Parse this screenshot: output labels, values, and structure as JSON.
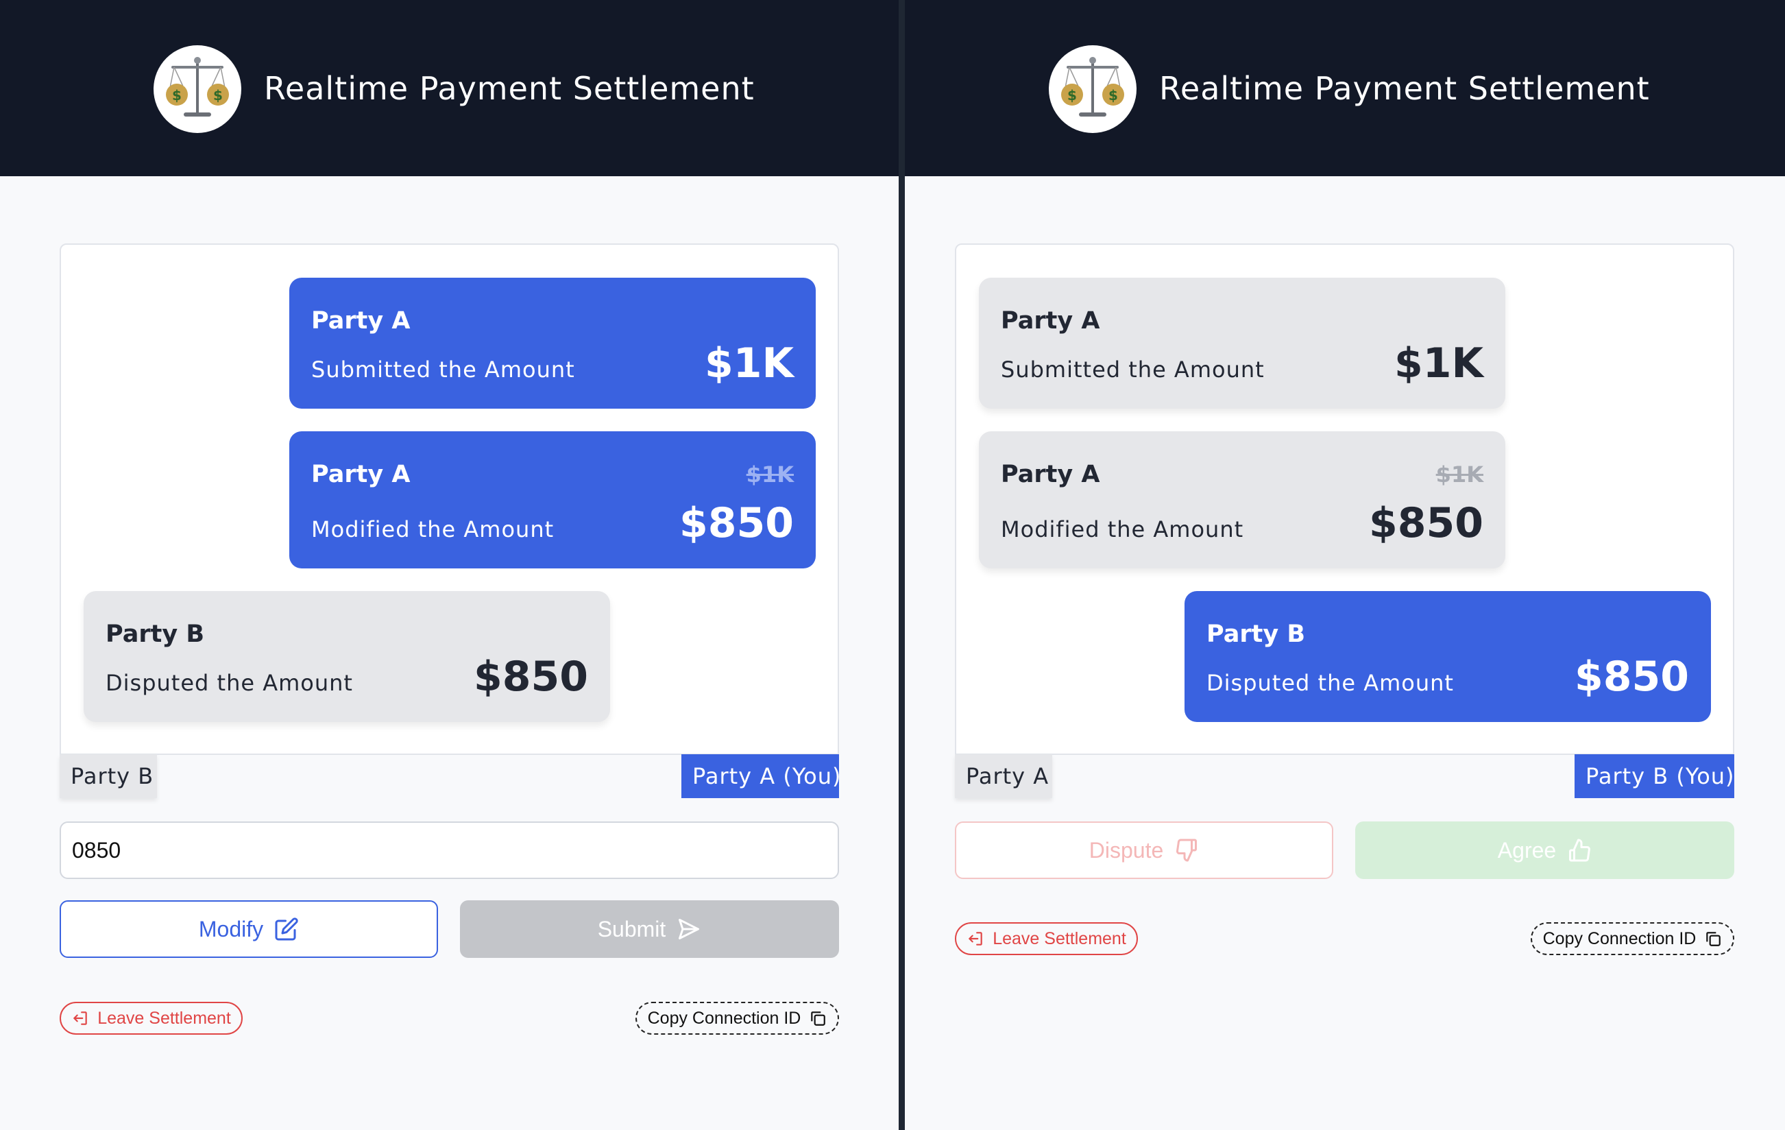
{
  "app": {
    "title": "Realtime Payment Settlement",
    "logo_icon": "scales-money-bags-icon"
  },
  "left": {
    "messages": [
      {
        "party": "Party A",
        "action": "Submitted the Amount",
        "amount": "$1K",
        "old_amount": "",
        "style": "blue"
      },
      {
        "party": "Party A",
        "action": "Modified the Amount",
        "amount": "$850",
        "old_amount": "$1K",
        "style": "blue"
      },
      {
        "party": "Party B",
        "action": "Disputed the Amount",
        "amount": "$850",
        "old_amount": "",
        "style": "grey"
      }
    ],
    "other_party_label": "Party B",
    "self_party_label": "Party A (You)",
    "amount_input_value": "0850",
    "modify_label": "Modify",
    "submit_label": "Submit",
    "leave_label": "Leave Settlement",
    "copy_label": "Copy Connection ID"
  },
  "right": {
    "messages": [
      {
        "party": "Party A",
        "action": "Submitted the Amount",
        "amount": "$1K",
        "old_amount": "",
        "style": "grey"
      },
      {
        "party": "Party A",
        "action": "Modified the Amount",
        "amount": "$850",
        "old_amount": "$1K",
        "style": "grey"
      },
      {
        "party": "Party B",
        "action": "Disputed the Amount",
        "amount": "$850",
        "old_amount": "",
        "style": "blue"
      }
    ],
    "other_party_label": "Party A",
    "self_party_label": "Party B (You)",
    "dispute_label": "Dispute",
    "agree_label": "Agree",
    "leave_label": "Leave Settlement",
    "copy_label": "Copy Connection ID"
  },
  "colors": {
    "header_bg": "#121827",
    "accent_blue": "#3a62e0",
    "bubble_grey": "#e6e7ea",
    "danger_red": "#e04545",
    "agree_green": "#d6efd9"
  }
}
